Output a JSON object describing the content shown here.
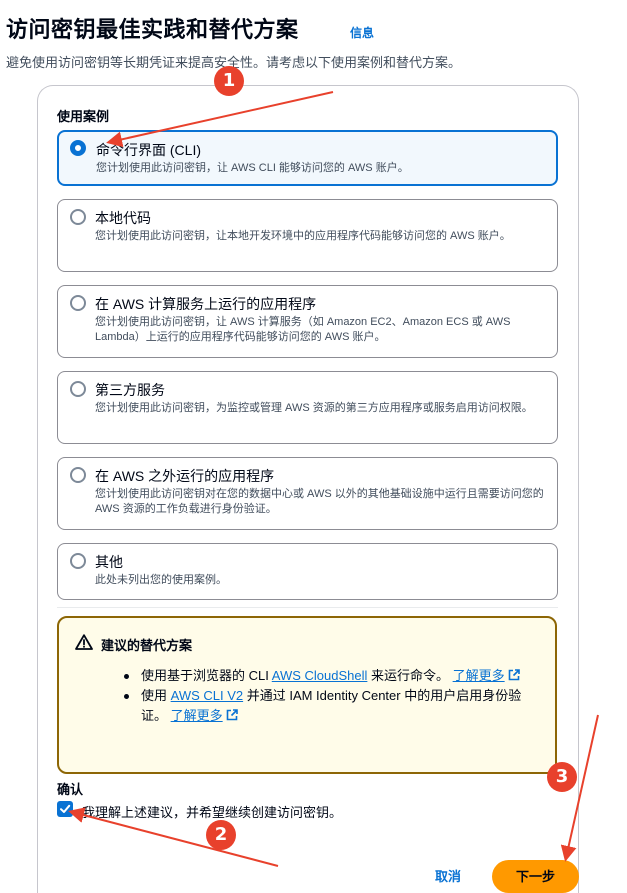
{
  "header": {
    "title": "访问密钥最佳实践和替代方案",
    "info_link": "信息",
    "subtitle": "避免使用访问密钥等长期凭证来提高安全性。请考虑以下使用案例和替代方案。"
  },
  "use_cases": {
    "label": "使用案例",
    "options": [
      {
        "title": "命令行界面 (CLI)",
        "desc": "您计划使用此访问密钥，让 AWS CLI 能够访问您的 AWS 账户。",
        "selected": true
      },
      {
        "title": "本地代码",
        "desc": "您计划使用此访问密钥，让本地开发环境中的应用程序代码能够访问您的 AWS 账户。",
        "selected": false
      },
      {
        "title": "在 AWS 计算服务上运行的应用程序",
        "desc": "您计划使用此访问密钥，让 AWS 计算服务（如 Amazon EC2、Amazon ECS 或 AWS Lambda）上运行的应用程序代码能够访问您的 AWS 账户。",
        "selected": false
      },
      {
        "title": "第三方服务",
        "desc": "您计划使用此访问密钥，为监控或管理 AWS 资源的第三方应用程序或服务启用访问权限。",
        "selected": false
      },
      {
        "title": "在 AWS 之外运行的应用程序",
        "desc": "您计划使用此访问密钥对在您的数据中心或 AWS 以外的其他基础设施中运行且需要访问您的 AWS 资源的工作负载进行身份验证。",
        "selected": false
      },
      {
        "title": "其他",
        "desc": "此处未列出您的使用案例。",
        "selected": false
      }
    ]
  },
  "alert": {
    "title": "建议的替代方案",
    "item1": {
      "prefix": "使用基于浏览器的 CLI ",
      "link": "AWS CloudShell",
      "suffix": " 来运行命令。",
      "learn_more": "了解更多"
    },
    "item2": {
      "prefix": "使用 ",
      "link": "AWS CLI V2",
      "suffix": " 并通过 IAM Identity Center 中的用户启用身份验证。",
      "learn_more": "了解更多"
    }
  },
  "confirm": {
    "label": "确认",
    "checkbox_text": "我理解上述建议，并希望继续创建访问密钥。",
    "checked": true
  },
  "footer": {
    "cancel_label": "取消",
    "next_label": "下一步"
  },
  "annotations": {
    "badge1": "1",
    "badge2": "2",
    "badge3": "3",
    "color": "#e8412c"
  },
  "colors": {
    "accent": "#0972d3",
    "primary_button": "#ff9900",
    "warning_border": "#8d6605",
    "warning_bg": "#fffce9"
  }
}
